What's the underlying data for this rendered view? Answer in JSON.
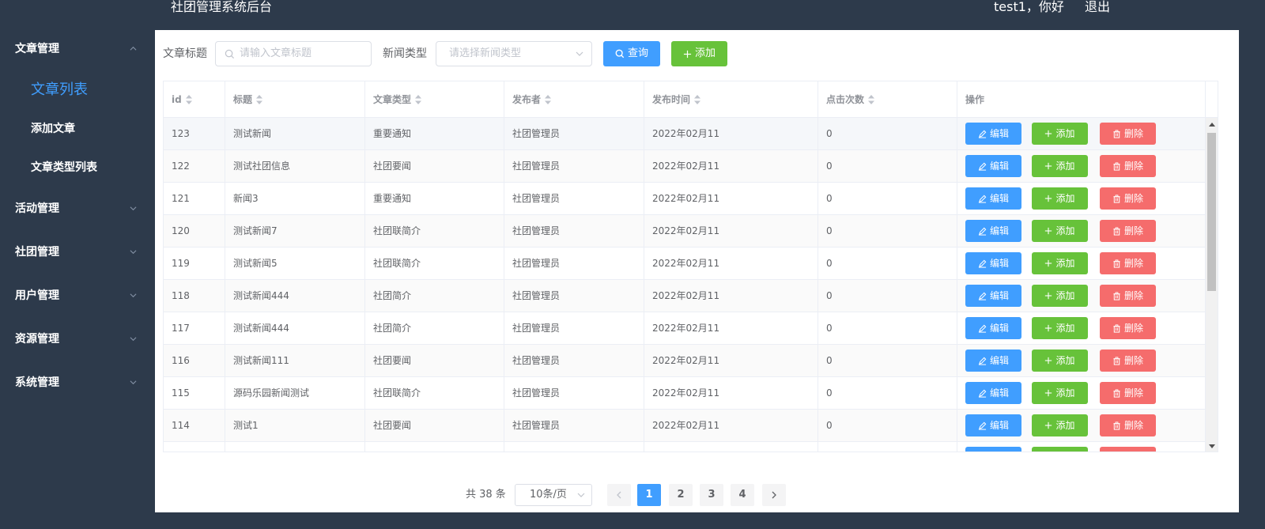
{
  "header": {
    "title": "社团管理系统后台",
    "greeting": "test1，你好",
    "logout": "退出"
  },
  "sidebar": {
    "groups": [
      {
        "label": "文章管理",
        "expanded": true
      },
      {
        "label": "活动管理",
        "expanded": false
      },
      {
        "label": "社团管理",
        "expanded": false
      },
      {
        "label": "用户管理",
        "expanded": false
      },
      {
        "label": "资源管理",
        "expanded": false
      },
      {
        "label": "系统管理",
        "expanded": false
      }
    ],
    "subitems": [
      {
        "label": "文章列表",
        "active": true
      },
      {
        "label": "添加文章",
        "active": false
      },
      {
        "label": "文章类型列表",
        "active": false
      }
    ]
  },
  "filters": {
    "title_label": "文章标题",
    "title_placeholder": "请输入文章标题",
    "type_label": "新闻类型",
    "type_placeholder": "请选择新闻类型",
    "search_button": "查询",
    "add_button": "添加"
  },
  "table": {
    "columns": [
      "id",
      "标题",
      "文章类型",
      "发布者",
      "发布时间",
      "点击次数",
      "操作"
    ],
    "rows": [
      {
        "id": "123",
        "title": "测试新闻",
        "type": "重要通知",
        "publisher": "社团管理员",
        "time": "2022年02月11",
        "clicks": "0"
      },
      {
        "id": "122",
        "title": "测试社团信息",
        "type": "社团要闻",
        "publisher": "社团管理员",
        "time": "2022年02月11",
        "clicks": "0"
      },
      {
        "id": "121",
        "title": "新闻3",
        "type": "重要通知",
        "publisher": "社团管理员",
        "time": "2022年02月11",
        "clicks": "0"
      },
      {
        "id": "120",
        "title": "测试新闻7",
        "type": "社团联简介",
        "publisher": "社团管理员",
        "time": "2022年02月11",
        "clicks": "0"
      },
      {
        "id": "119",
        "title": "测试新闻5",
        "type": "社团联简介",
        "publisher": "社团管理员",
        "time": "2022年02月11",
        "clicks": "0"
      },
      {
        "id": "118",
        "title": "测试新闻444",
        "type": "社团简介",
        "publisher": "社团管理员",
        "time": "2022年02月11",
        "clicks": "0"
      },
      {
        "id": "117",
        "title": "测试新闻444",
        "type": "社团简介",
        "publisher": "社团管理员",
        "time": "2022年02月11",
        "clicks": "0"
      },
      {
        "id": "116",
        "title": "测试新闻111",
        "type": "社团要闻",
        "publisher": "社团管理员",
        "time": "2022年02月11",
        "clicks": "0"
      },
      {
        "id": "115",
        "title": "源码乐园新闻测试",
        "type": "社团联简介",
        "publisher": "社团管理员",
        "time": "2022年02月11",
        "clicks": "0"
      },
      {
        "id": "114",
        "title": "测试1",
        "type": "社团要闻",
        "publisher": "社团管理员",
        "time": "2022年02月11",
        "clicks": "0"
      },
      {
        "id": "",
        "title": "",
        "type": "",
        "publisher": "",
        "time": "",
        "clicks": ""
      }
    ],
    "row_actions": {
      "edit": "编辑",
      "add": "添加",
      "delete": "删除"
    }
  },
  "pagination": {
    "total": "共 38 条",
    "page_size": "10条/页",
    "pages": [
      "1",
      "2",
      "3",
      "4"
    ],
    "current": "1"
  },
  "colors": {
    "primary": "#409eff",
    "success": "#67c23a",
    "danger": "#f56c6c",
    "sidebar": "#2d3a4b"
  }
}
